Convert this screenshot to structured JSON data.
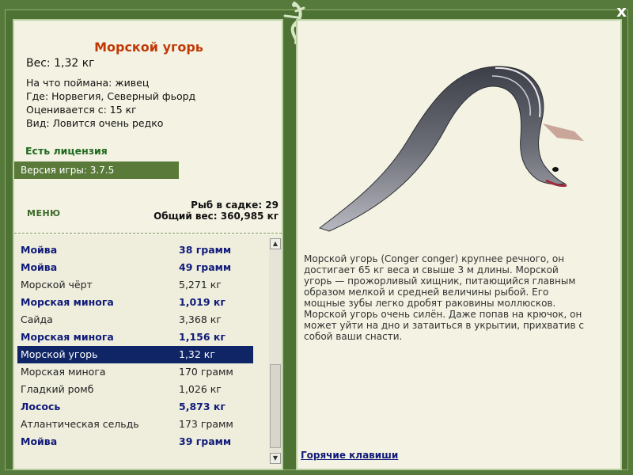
{
  "header": {
    "close_symbol": "x"
  },
  "fish": {
    "name": "Морской угорь",
    "weight_line": "Вес: 1,32 кг",
    "bait_line": "На что поймана: живец",
    "location_line": "Где: Норвегия, Северный фьорд",
    "value_line": "Оценивается с: 15 кг",
    "rarity_line": "Вид: Ловится очень редко",
    "description": "Морской угорь (Conger conger) крупнее речного, он достигает 65 кг веса и свыше 3 м длины. Морской угорь — прожорливый хищник, питающийся главным образом мелкой и средней величины рыбой. Его мощные зубы легко дробят раковины моллюсков. Морской угорь очень силён. Даже попав на крючок, он может уйти на дно и затаиться в укрытии, прихватив с собой ваши снасти."
  },
  "license_label": "Есть лицензия",
  "version_label": "Версия игры: 3.7.5",
  "menu_label": "МЕНЮ",
  "stats": {
    "fish_in_keepnet": "Рыб в садке: 29",
    "total_weight": "Общий вес: 360,985 кг"
  },
  "catch_list": [
    {
      "name": "Мойва",
      "weight": "38 грамм",
      "style": "bold"
    },
    {
      "name": "Мойва",
      "weight": "49 грамм",
      "style": "bold"
    },
    {
      "name": "Морской чёрт",
      "weight": "5,271 кг",
      "style": "normal"
    },
    {
      "name": "Морская минога",
      "weight": "1,019 кг",
      "style": "bold"
    },
    {
      "name": "Сайда",
      "weight": "3,368 кг",
      "style": "normal"
    },
    {
      "name": "Морская минога",
      "weight": "1,156 кг",
      "style": "bold"
    },
    {
      "name": "Морской угорь",
      "weight": "1,32 кг",
      "style": "selected"
    },
    {
      "name": "Морская минога",
      "weight": "170 грамм",
      "style": "normal"
    },
    {
      "name": "Гладкий ромб",
      "weight": "1,026 кг",
      "style": "normal"
    },
    {
      "name": "Лосось",
      "weight": "5,873 кг",
      "style": "bold"
    },
    {
      "name": "Атлантическая сельдь",
      "weight": "173 грамм",
      "style": "normal"
    },
    {
      "name": "Мойва",
      "weight": "39 грамм",
      "style": "bold"
    }
  ],
  "scrollbar": {
    "up_arrow": "▲",
    "down_arrow": "▼"
  },
  "hotkeys_label": "Горячие клавиши",
  "colors": {
    "frame": "#567a3c",
    "panel": "#f4f2e2",
    "title": "#c03a08",
    "link": "#101b7a",
    "selection": "#0f2566"
  }
}
